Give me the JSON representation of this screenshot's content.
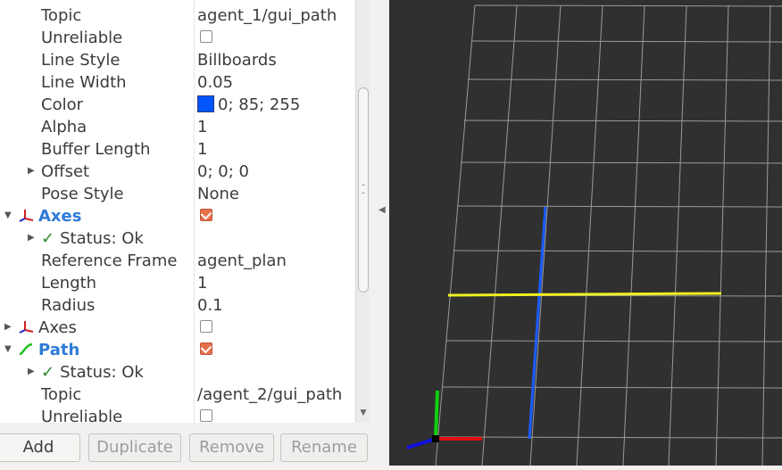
{
  "properties": {
    "rows": [
      {
        "label": "Topic",
        "value": "agent_1/gui_path"
      },
      {
        "label": "Unreliable",
        "value": ""
      },
      {
        "label": "Line Style",
        "value": "Billboards"
      },
      {
        "label": "Line Width",
        "value": "0.05"
      },
      {
        "label": "Color",
        "value": "0; 85; 255"
      },
      {
        "label": "Alpha",
        "value": "1"
      },
      {
        "label": "Buffer Length",
        "value": "1"
      },
      {
        "label": "Offset",
        "value": "0; 0; 0"
      },
      {
        "label": "Pose Style",
        "value": "None"
      },
      {
        "label": "Axes",
        "value": ""
      },
      {
        "label": "Status: Ok",
        "value": ""
      },
      {
        "label": "Reference Frame",
        "value": "agent_plan"
      },
      {
        "label": "Length",
        "value": "1"
      },
      {
        "label": "Radius",
        "value": "0.1"
      },
      {
        "label": "Axes",
        "value": ""
      },
      {
        "label": "Path",
        "value": ""
      },
      {
        "label": "Status: Ok",
        "value": ""
      },
      {
        "label": "Topic",
        "value": "/agent_2/gui_path"
      },
      {
        "label": "Unreliable",
        "value": ""
      }
    ],
    "color_value": "#0055ff"
  },
  "buttons": {
    "add": "Add",
    "duplicate": "Duplicate",
    "remove": "Remove",
    "rename": "Rename"
  },
  "view": {
    "background": "#303030",
    "grid_color": "#a0a0a0",
    "path_blue": "#1a5cff",
    "path_yellow": "#f0f020",
    "axis_red": "#e01010",
    "axis_green": "#10d010",
    "axis_blue": "#1010e0"
  }
}
